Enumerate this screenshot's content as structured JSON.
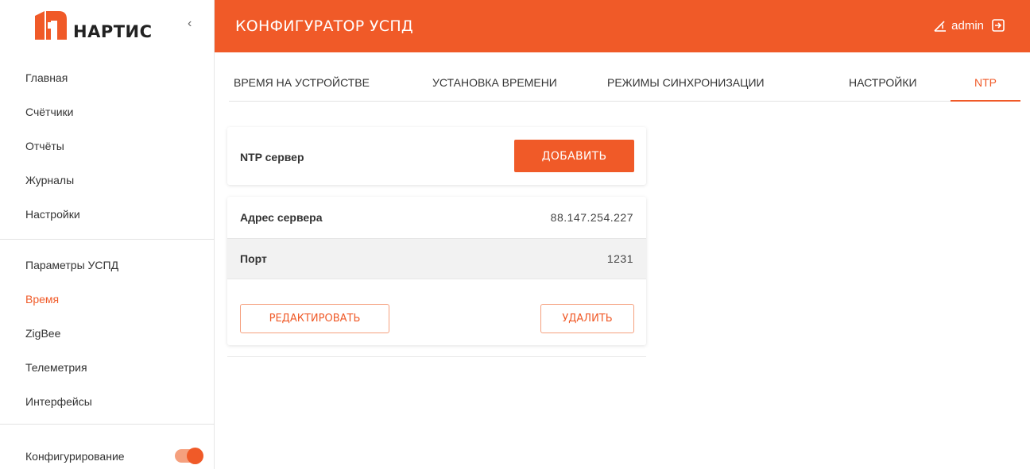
{
  "brand": {
    "name": "НАРТИС",
    "accent": "#f05a28"
  },
  "sidebar": {
    "collapse_icon": "chevron-left-icon",
    "group1": [
      {
        "label": "Главная"
      },
      {
        "label": "Счётчики"
      },
      {
        "label": "Отчёты"
      },
      {
        "label": "Журналы"
      },
      {
        "label": "Настройки"
      }
    ],
    "group2": [
      {
        "label": "Параметры УСПД"
      },
      {
        "label": "Время",
        "active": true
      },
      {
        "label": "ZigBee"
      },
      {
        "label": "Телеметрия"
      },
      {
        "label": "Интерфейсы"
      }
    ],
    "config_label": "Конфигурирование",
    "config_toggle_on": true
  },
  "header": {
    "title": "КОНФИГУРАТОР УСПД",
    "user": "admin",
    "user_icon": "user-warning-icon",
    "logout_icon": "logout-icon"
  },
  "tabs": [
    {
      "label": "Время на устройстве"
    },
    {
      "label": "Установка времени"
    },
    {
      "label": "Режимы синхронизации"
    },
    {
      "label": "Настройки"
    },
    {
      "label": "NTP",
      "active": true
    }
  ],
  "ntp_card": {
    "label": "NTP сервер",
    "add_button": "ДОБАВИТЬ"
  },
  "server_card": {
    "rows": [
      {
        "key": "Адрес сервера",
        "value": "88.147.254.227"
      },
      {
        "key": "Порт",
        "value": "1231"
      }
    ],
    "edit_button": "РЕДАКТИРОВАТЬ",
    "delete_button": "УДАЛИТЬ"
  }
}
